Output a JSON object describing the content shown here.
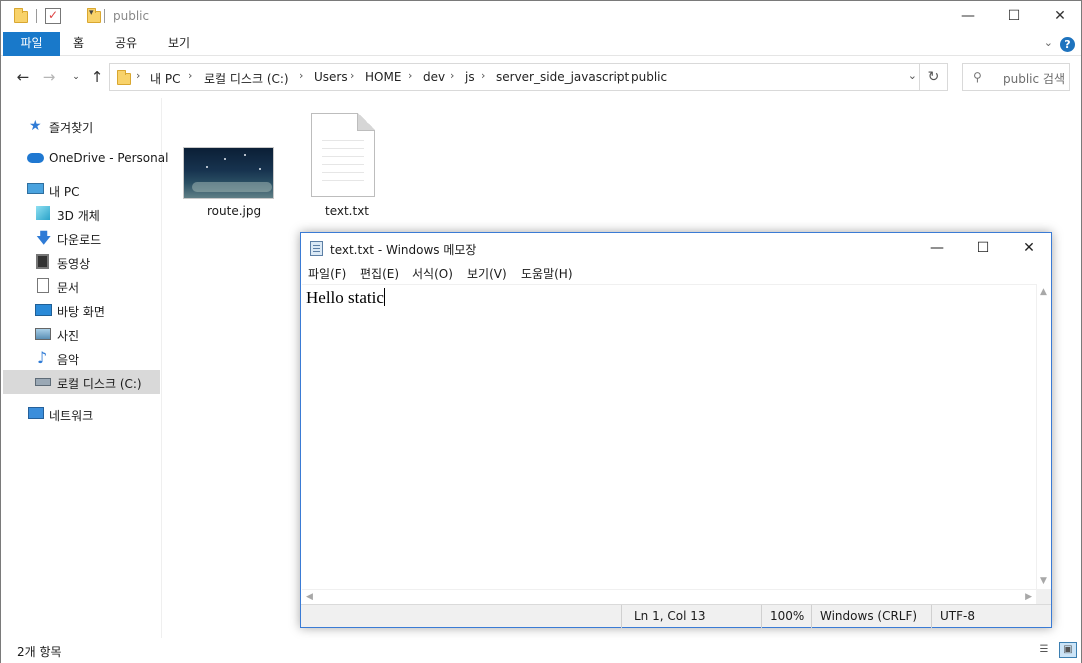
{
  "explorer": {
    "title": "public",
    "ribbon_tabs": [
      "파일",
      "홈",
      "공유",
      "보기"
    ],
    "help_label": "?",
    "breadcrumb": [
      "내 PC",
      "로컬 디스크 (C:)",
      "Users",
      "HOME",
      "dev",
      "js",
      "server_side_javascript",
      "public"
    ],
    "search_placeholder": "public 검색",
    "nav": {
      "quick_access": "즐겨찾기",
      "onedrive": "OneDrive - Personal",
      "this_pc": "내 PC",
      "objects_3d": "3D 개체",
      "downloads": "다운로드",
      "videos": "동영상",
      "documents": "문서",
      "desktop": "바탕 화면",
      "pictures": "사진",
      "music": "음악",
      "local_disk": "로컬 디스크 (C:)",
      "network": "네트워크"
    },
    "files": [
      {
        "name": "route.jpg",
        "icon": "image-thumbnail"
      },
      {
        "name": "text.txt",
        "icon": "text-file-icon"
      }
    ],
    "status": "2개 항목",
    "colors": {
      "accent": "#1979ca",
      "selected_nav": "#d9d9d9"
    }
  },
  "notepad": {
    "title": "text.txt - Windows 메모장",
    "menu": [
      "파일(F)",
      "편집(E)",
      "서식(O)",
      "보기(V)",
      "도움말(H)"
    ],
    "content": "Hello static",
    "status": {
      "position": "Ln 1, Col 13",
      "zoom": "100%",
      "line_ending": "Windows (CRLF)",
      "encoding": "UTF-8"
    }
  }
}
